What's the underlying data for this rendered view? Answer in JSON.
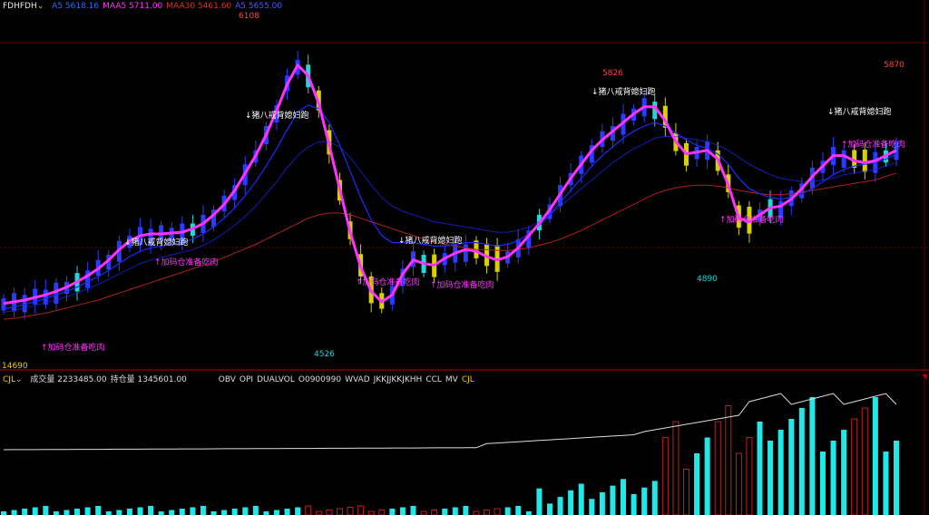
{
  "header": {
    "symbol": "FDHFDH",
    "indicators": [
      {
        "label": "A5",
        "value": "5618.16",
        "color": "#2b6cff"
      },
      {
        "label": "MAA5",
        "value": "5711.00",
        "color": "#ff33ff"
      },
      {
        "label": "MAA30",
        "value": "5461.60",
        "color": "#e03030"
      },
      {
        "label": "A5",
        "value": "5655.00",
        "color": "#4b5bff"
      }
    ]
  },
  "volume_header": {
    "name": "CJL",
    "items": [
      "成交量 2233485.00",
      "持仓量 1345601.00"
    ],
    "tabs": [
      "OBV",
      "OPI",
      "DUALVOL",
      "O0900990",
      "WVAD",
      "JKKJJKKJKHH",
      "CCL",
      "MV",
      "CJL"
    ]
  },
  "annotations": {
    "high1": "6108",
    "high2": "5826",
    "high3": "5870",
    "low1": "4526",
    "low2": "4890",
    "left_low": "14690",
    "sell_label": "↓猪八戒背媳妇跑",
    "buy_label": "↑加码仓准备吃肉"
  },
  "colors": {
    "up_candle": "#2a3cff",
    "down_candle": "#d8d000",
    "mid_candle": "#20d8d8",
    "ma_fast": "#ff33ff",
    "ma_mid": "#1a2cff",
    "ma_slow": "#b02020",
    "vol_up": "#20e8e8",
    "vol_down": "#c02020",
    "obv": "#dddddd"
  },
  "chart_data": {
    "type": "line",
    "title": "",
    "xlabel": "",
    "ylabel": "",
    "ylim": [
      4300,
      6300
    ],
    "series": [
      {
        "name": "MAA5",
        "values": [
          4650,
          4660,
          4670,
          4685,
          4700,
          4720,
          4745,
          4775,
          4810,
          4850,
          4900,
          4960,
          5010,
          5040,
          5050,
          5050,
          5055,
          5060,
          5080,
          5110,
          5160,
          5220,
          5300,
          5400,
          5500,
          5620,
          5760,
          5910,
          6020,
          5960,
          5800,
          5560,
          5310,
          5060,
          4860,
          4720,
          4660,
          4700,
          4820,
          4900,
          4880,
          4870,
          4910,
          4940,
          4960,
          4950,
          4920,
          4900,
          4920,
          4970,
          5040,
          5110,
          5190,
          5280,
          5370,
          5450,
          5530,
          5590,
          5640,
          5690,
          5740,
          5780,
          5780,
          5700,
          5580,
          5510,
          5520,
          5530,
          5480,
          5330,
          5140,
          5120,
          5160,
          5200,
          5210,
          5250,
          5310,
          5380,
          5440,
          5500,
          5500,
          5470,
          5460,
          5470,
          5500,
          5530
        ]
      },
      {
        "name": "A5",
        "values": [
          4620,
          4630,
          4645,
          4660,
          4680,
          4700,
          4720,
          4745,
          4775,
          4805,
          4840,
          4880,
          4920,
          4950,
          4970,
          4980,
          4990,
          5000,
          5020,
          5050,
          5090,
          5140,
          5200,
          5270,
          5350,
          5440,
          5540,
          5650,
          5750,
          5790,
          5770,
          5690,
          5560,
          5410,
          5260,
          5130,
          5040,
          5000,
          5000,
          5000,
          4990,
          4980,
          4980,
          4990,
          5000,
          5000,
          4990,
          4980,
          4990,
          5010,
          5050,
          5100,
          5160,
          5230,
          5300,
          5370,
          5440,
          5500,
          5550,
          5600,
          5640,
          5670,
          5690,
          5670,
          5630,
          5590,
          5560,
          5540,
          5510,
          5450,
          5370,
          5310,
          5280,
          5260,
          5250,
          5260,
          5280,
          5310,
          5350,
          5390,
          5420,
          5440,
          5450,
          5460,
          5480,
          5510
        ]
      },
      {
        "name": "A5",
        "values": [
          4600,
          4610,
          4625,
          4640,
          4655,
          4670,
          4690,
          4710,
          4735,
          4760,
          4790,
          4820,
          4850,
          4880,
          4900,
          4915,
          4930,
          4945,
          4960,
          4985,
          5015,
          5055,
          5100,
          5150,
          5210,
          5280,
          5350,
          5430,
          5500,
          5550,
          5580,
          5580,
          5550,
          5490,
          5410,
          5330,
          5260,
          5210,
          5180,
          5160,
          5140,
          5120,
          5110,
          5100,
          5090,
          5080,
          5070,
          5060,
          5060,
          5070,
          5090,
          5120,
          5160,
          5210,
          5260,
          5310,
          5360,
          5410,
          5460,
          5500,
          5540,
          5570,
          5600,
          5610,
          5610,
          5600,
          5590,
          5580,
          5560,
          5530,
          5490,
          5450,
          5420,
          5390,
          5370,
          5360,
          5350,
          5350,
          5360,
          5370,
          5390,
          5400,
          5410,
          5420,
          5440,
          5460
        ]
      },
      {
        "name": "MAA30",
        "values": [
          4560,
          4565,
          4575,
          4585,
          4595,
          4610,
          4625,
          4640,
          4655,
          4670,
          4690,
          4710,
          4730,
          4750,
          4770,
          4790,
          4810,
          4830,
          4850,
          4870,
          4890,
          4915,
          4940,
          4965,
          4990,
          5020,
          5050,
          5080,
          5110,
          5140,
          5160,
          5170,
          5170,
          5160,
          5140,
          5120,
          5100,
          5080,
          5060,
          5040,
          5020,
          5000,
          4990,
          4980,
          4970,
          4960,
          4960,
          4955,
          4955,
          4960,
          4970,
          4985,
          5000,
          5020,
          5045,
          5070,
          5100,
          5130,
          5160,
          5190,
          5220,
          5250,
          5280,
          5300,
          5315,
          5325,
          5330,
          5330,
          5325,
          5315,
          5300,
          5290,
          5280,
          5275,
          5275,
          5280,
          5290,
          5300,
          5310,
          5320,
          5330,
          5340,
          5350,
          5360,
          5380,
          5400
        ]
      }
    ]
  }
}
